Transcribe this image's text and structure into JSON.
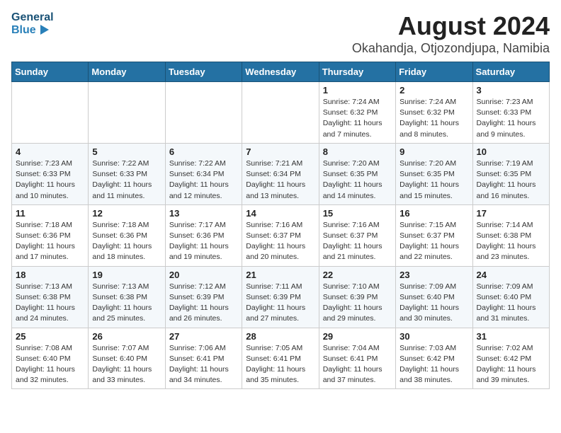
{
  "logo": {
    "line1": "General",
    "line2": "Blue"
  },
  "title": {
    "month_year": "August 2024",
    "location": "Okahandja, Otjozondjupa, Namibia"
  },
  "weekdays": [
    "Sunday",
    "Monday",
    "Tuesday",
    "Wednesday",
    "Thursday",
    "Friday",
    "Saturday"
  ],
  "weeks": [
    [
      {
        "day": "",
        "info": ""
      },
      {
        "day": "",
        "info": ""
      },
      {
        "day": "",
        "info": ""
      },
      {
        "day": "",
        "info": ""
      },
      {
        "day": "1",
        "info": "Sunrise: 7:24 AM\nSunset: 6:32 PM\nDaylight: 11 hours\nand 7 minutes."
      },
      {
        "day": "2",
        "info": "Sunrise: 7:24 AM\nSunset: 6:32 PM\nDaylight: 11 hours\nand 8 minutes."
      },
      {
        "day": "3",
        "info": "Sunrise: 7:23 AM\nSunset: 6:33 PM\nDaylight: 11 hours\nand 9 minutes."
      }
    ],
    [
      {
        "day": "4",
        "info": "Sunrise: 7:23 AM\nSunset: 6:33 PM\nDaylight: 11 hours\nand 10 minutes."
      },
      {
        "day": "5",
        "info": "Sunrise: 7:22 AM\nSunset: 6:33 PM\nDaylight: 11 hours\nand 11 minutes."
      },
      {
        "day": "6",
        "info": "Sunrise: 7:22 AM\nSunset: 6:34 PM\nDaylight: 11 hours\nand 12 minutes."
      },
      {
        "day": "7",
        "info": "Sunrise: 7:21 AM\nSunset: 6:34 PM\nDaylight: 11 hours\nand 13 minutes."
      },
      {
        "day": "8",
        "info": "Sunrise: 7:20 AM\nSunset: 6:35 PM\nDaylight: 11 hours\nand 14 minutes."
      },
      {
        "day": "9",
        "info": "Sunrise: 7:20 AM\nSunset: 6:35 PM\nDaylight: 11 hours\nand 15 minutes."
      },
      {
        "day": "10",
        "info": "Sunrise: 7:19 AM\nSunset: 6:35 PM\nDaylight: 11 hours\nand 16 minutes."
      }
    ],
    [
      {
        "day": "11",
        "info": "Sunrise: 7:18 AM\nSunset: 6:36 PM\nDaylight: 11 hours\nand 17 minutes."
      },
      {
        "day": "12",
        "info": "Sunrise: 7:18 AM\nSunset: 6:36 PM\nDaylight: 11 hours\nand 18 minutes."
      },
      {
        "day": "13",
        "info": "Sunrise: 7:17 AM\nSunset: 6:36 PM\nDaylight: 11 hours\nand 19 minutes."
      },
      {
        "day": "14",
        "info": "Sunrise: 7:16 AM\nSunset: 6:37 PM\nDaylight: 11 hours\nand 20 minutes."
      },
      {
        "day": "15",
        "info": "Sunrise: 7:16 AM\nSunset: 6:37 PM\nDaylight: 11 hours\nand 21 minutes."
      },
      {
        "day": "16",
        "info": "Sunrise: 7:15 AM\nSunset: 6:37 PM\nDaylight: 11 hours\nand 22 minutes."
      },
      {
        "day": "17",
        "info": "Sunrise: 7:14 AM\nSunset: 6:38 PM\nDaylight: 11 hours\nand 23 minutes."
      }
    ],
    [
      {
        "day": "18",
        "info": "Sunrise: 7:13 AM\nSunset: 6:38 PM\nDaylight: 11 hours\nand 24 minutes."
      },
      {
        "day": "19",
        "info": "Sunrise: 7:13 AM\nSunset: 6:38 PM\nDaylight: 11 hours\nand 25 minutes."
      },
      {
        "day": "20",
        "info": "Sunrise: 7:12 AM\nSunset: 6:39 PM\nDaylight: 11 hours\nand 26 minutes."
      },
      {
        "day": "21",
        "info": "Sunrise: 7:11 AM\nSunset: 6:39 PM\nDaylight: 11 hours\nand 27 minutes."
      },
      {
        "day": "22",
        "info": "Sunrise: 7:10 AM\nSunset: 6:39 PM\nDaylight: 11 hours\nand 29 minutes."
      },
      {
        "day": "23",
        "info": "Sunrise: 7:09 AM\nSunset: 6:40 PM\nDaylight: 11 hours\nand 30 minutes."
      },
      {
        "day": "24",
        "info": "Sunrise: 7:09 AM\nSunset: 6:40 PM\nDaylight: 11 hours\nand 31 minutes."
      }
    ],
    [
      {
        "day": "25",
        "info": "Sunrise: 7:08 AM\nSunset: 6:40 PM\nDaylight: 11 hours\nand 32 minutes."
      },
      {
        "day": "26",
        "info": "Sunrise: 7:07 AM\nSunset: 6:40 PM\nDaylight: 11 hours\nand 33 minutes."
      },
      {
        "day": "27",
        "info": "Sunrise: 7:06 AM\nSunset: 6:41 PM\nDaylight: 11 hours\nand 34 minutes."
      },
      {
        "day": "28",
        "info": "Sunrise: 7:05 AM\nSunset: 6:41 PM\nDaylight: 11 hours\nand 35 minutes."
      },
      {
        "day": "29",
        "info": "Sunrise: 7:04 AM\nSunset: 6:41 PM\nDaylight: 11 hours\nand 37 minutes."
      },
      {
        "day": "30",
        "info": "Sunrise: 7:03 AM\nSunset: 6:42 PM\nDaylight: 11 hours\nand 38 minutes."
      },
      {
        "day": "31",
        "info": "Sunrise: 7:02 AM\nSunset: 6:42 PM\nDaylight: 11 hours\nand 39 minutes."
      }
    ]
  ]
}
